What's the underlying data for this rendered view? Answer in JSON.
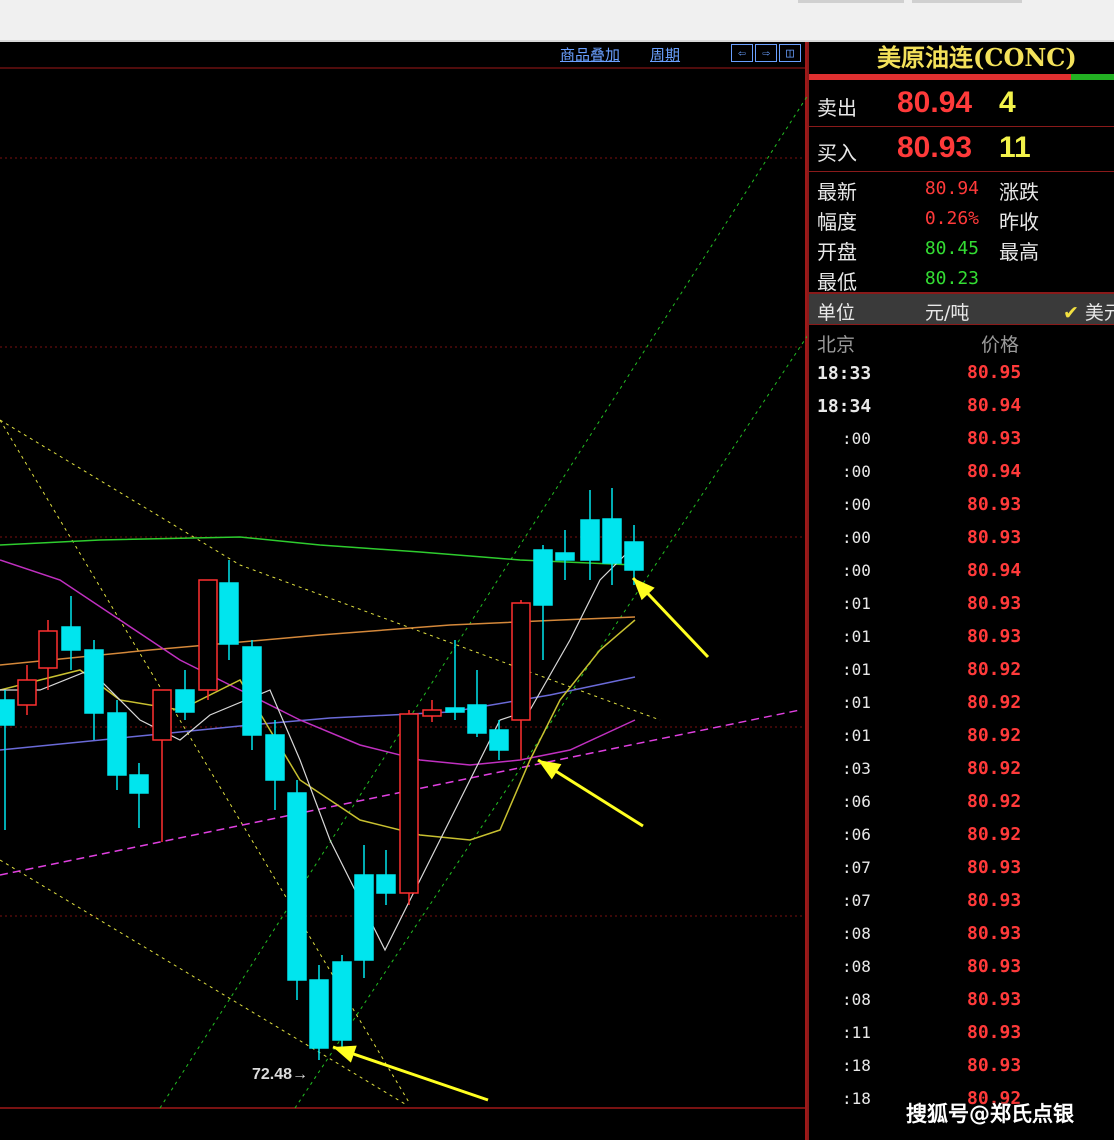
{
  "toolbar": {
    "overlay_label": "商品叠加",
    "period_label": "周期",
    "btn_left": "⇦",
    "btn_right": "⇨",
    "btn_layout": "◫"
  },
  "chart": {
    "low_label": "72.48",
    "low_arrow": "→"
  },
  "panel": {
    "title": "美原油连(CONC)",
    "sell": {
      "label": "卖出",
      "price": "80.94",
      "qty": "4"
    },
    "buy": {
      "label": "买入",
      "price": "80.93",
      "qty": "11"
    },
    "stats": {
      "latest_label": "最新",
      "latest_value": "80.94",
      "change_label": "涨跌",
      "amp_label": "幅度",
      "amp_value": "0.26%",
      "prevclose_label": "昨收",
      "open_label": "开盘",
      "open_value": "80.45",
      "high_label": "最高",
      "low_label": "最低",
      "low_value": "80.23"
    },
    "unit": {
      "label": "单位",
      "value": "元/吨",
      "currency": "美元"
    },
    "table_head": {
      "time": "北京",
      "price": "价格"
    },
    "ticks": [
      {
        "time": "18:33",
        "price": "80.95"
      },
      {
        "time": "18:34",
        "price": "80.94"
      },
      {
        "time": ":00",
        "price": "80.93"
      },
      {
        "time": ":00",
        "price": "80.94"
      },
      {
        "time": ":00",
        "price": "80.93"
      },
      {
        "time": ":00",
        "price": "80.93"
      },
      {
        "time": ":00",
        "price": "80.94"
      },
      {
        "time": ":01",
        "price": "80.93"
      },
      {
        "time": ":01",
        "price": "80.93"
      },
      {
        "time": ":01",
        "price": "80.92"
      },
      {
        "time": ":01",
        "price": "80.92"
      },
      {
        "time": ":01",
        "price": "80.92"
      },
      {
        "time": ":03",
        "price": "80.92"
      },
      {
        "time": ":06",
        "price": "80.92"
      },
      {
        "time": ":06",
        "price": "80.92"
      },
      {
        "time": ":07",
        "price": "80.93"
      },
      {
        "time": ":07",
        "price": "80.93"
      },
      {
        "time": ":08",
        "price": "80.93"
      },
      {
        "time": ":08",
        "price": "80.93"
      },
      {
        "time": ":08",
        "price": "80.93"
      },
      {
        "time": ":11",
        "price": "80.93"
      },
      {
        "time": ":18",
        "price": "80.93"
      },
      {
        "time": ":18",
        "price": "80.92"
      }
    ]
  },
  "watermark": "搜狐号@郑氏点银",
  "colors": {
    "bull": "#ff3030",
    "bear": "#00e5ee",
    "grid": "#7a1010",
    "value_red": "#ff3a3a",
    "value_green": "#33dd33"
  }
}
